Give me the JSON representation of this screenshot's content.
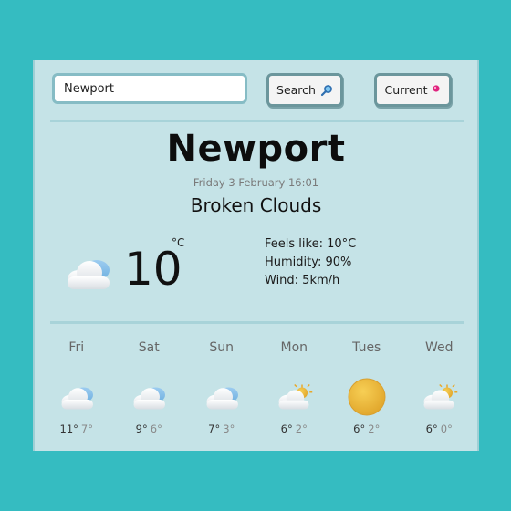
{
  "search": {
    "value": "Newport"
  },
  "buttons": {
    "search_label": "Search",
    "current_label": "Current"
  },
  "current": {
    "city": "Newport",
    "datetime": "Friday 3 February 16:01",
    "description": "Broken Clouds",
    "temperature": "10",
    "unit": "°C",
    "icon": "cloudy-icon",
    "feels_like": "Feels like: 10°C",
    "humidity": "Humidity: 90%",
    "wind": "Wind: 5km/h"
  },
  "forecast": [
    {
      "day": "Fri",
      "hi": "11°",
      "lo": "7°",
      "icon": "cloudy-icon"
    },
    {
      "day": "Sat",
      "hi": "9°",
      "lo": "6°",
      "icon": "cloudy-icon"
    },
    {
      "day": "Sun",
      "hi": "7°",
      "lo": "3°",
      "icon": "cloudy-icon"
    },
    {
      "day": "Mon",
      "hi": "6°",
      "lo": "2°",
      "icon": "partly-sunny-icon"
    },
    {
      "day": "Tues",
      "hi": "6°",
      "lo": "2°",
      "icon": "sun-icon"
    },
    {
      "day": "Wed",
      "hi": "6°",
      "lo": "0°",
      "icon": "partly-sunny-icon"
    }
  ]
}
